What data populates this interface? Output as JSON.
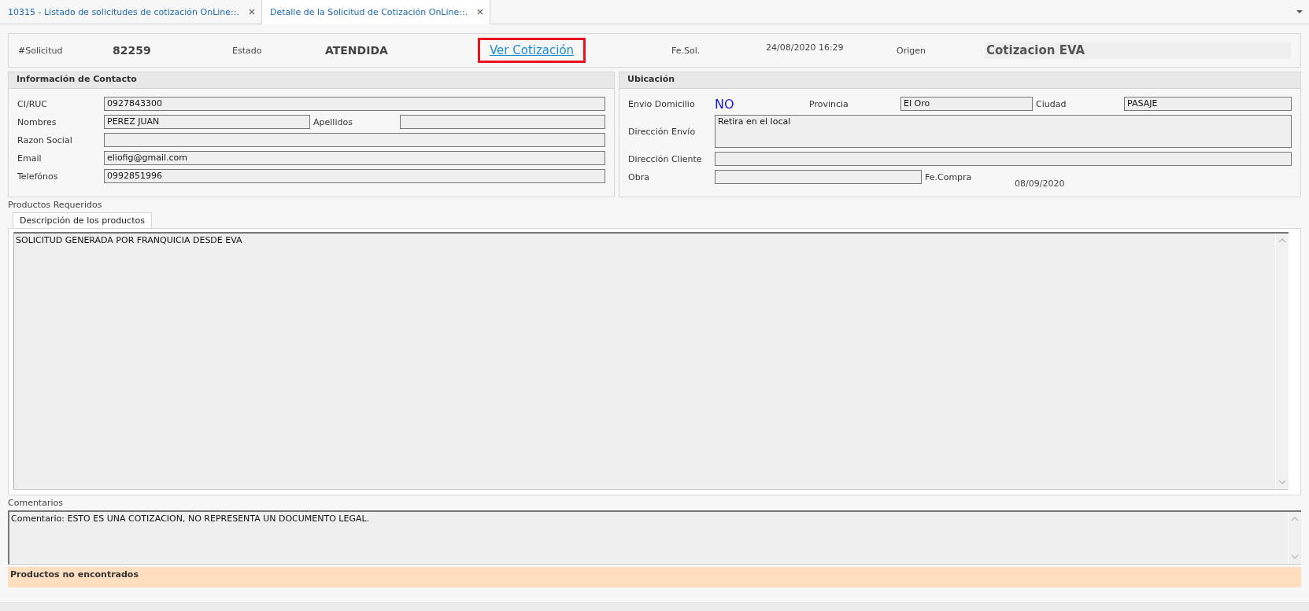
{
  "tabs": [
    {
      "label": "10315 - Listado de solicitudes de cotización OnLine::.",
      "selected": false
    },
    {
      "label": "Detalle de la Solicitud de Cotización OnLine::.",
      "selected": true
    }
  ],
  "header": {
    "solicitud": {
      "label": "#Solicitud",
      "value": "82259"
    },
    "estado": {
      "label": "Estado",
      "value": "ATENDIDA"
    },
    "link": {
      "label": "Ver Cotización",
      "highlighted": true
    },
    "fecha": {
      "label": "Fe.Sol.",
      "value": "24/08/2020 16:29"
    },
    "origen": {
      "label": "Origen",
      "value": "Cotizacion EVA"
    }
  },
  "contact": {
    "title": "Información de Contacto",
    "ci": {
      "label": "CI/RUC",
      "value": "0927843300"
    },
    "nombres": {
      "label": "Nombres",
      "value": "PEREZ JUAN"
    },
    "apellidos": {
      "label": "Apellidos"
    },
    "razon": {
      "label": "Razon Social"
    },
    "email": {
      "label": "Email",
      "value": "eliofig@gmail.com"
    },
    "telefonos": {
      "label": "Telefónos",
      "value": "0992851996"
    }
  },
  "location": {
    "title": "Ubicación",
    "envio": {
      "label": "Envio Domicilio",
      "value": "NO"
    },
    "provincia": {
      "label": "Provincia",
      "value": "El Oro"
    },
    "ciudad": {
      "label": "Ciudad",
      "value": "PASAJE"
    },
    "direccion_envio": {
      "label": "Dirección Envío",
      "value": "Retira en el local"
    },
    "direccion_cliente": {
      "label": "Dirección Cliente"
    },
    "obra": {
      "label": "Obra"
    },
    "fecha_compra": {
      "label": "Fe.Compra",
      "value": "08/09/2020"
    }
  },
  "products": {
    "label": "Productos Requeridos",
    "tabs": [
      {
        "label": "Descripción de los productos",
        "selected": true
      }
    ],
    "text": "SOLICITUD GENERADA POR FRANQUICIA DESDE EVA"
  },
  "comments": {
    "label": "Comentarios",
    "text": "Comentario: ESTO ES UNA COTIZACION, NO REPRESENTA UN DOCUMENTO LEGAL."
  },
  "notice": "Productos no encontrados"
}
